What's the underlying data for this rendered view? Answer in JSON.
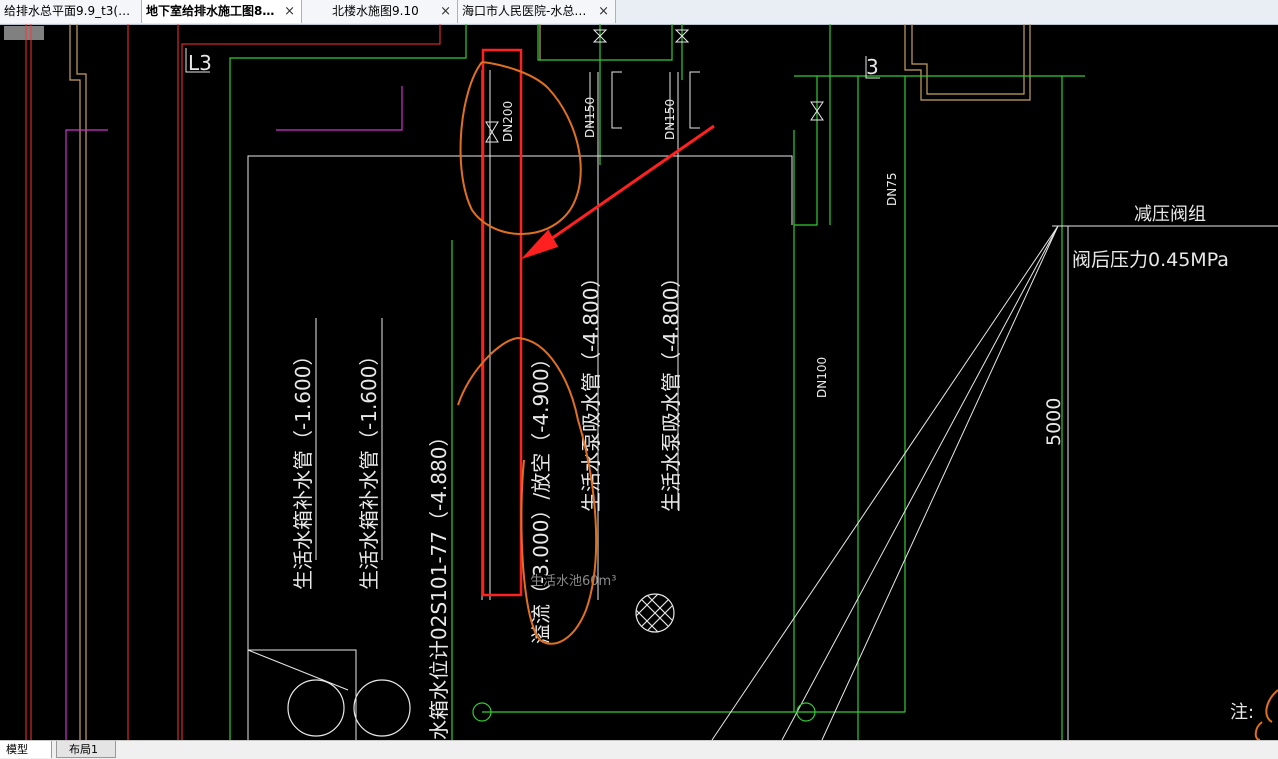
{
  "tabs": [
    {
      "label": "给排水总平面9.9_t3(…",
      "active": false
    },
    {
      "label": "地下室给排水施工图8…",
      "active": true
    },
    {
      "label": "北楼水施图9.10",
      "active": false
    },
    {
      "label": "海口市人民医院-水总…",
      "active": false
    }
  ],
  "close_glyph": "×",
  "drawing": {
    "tag_l3": "L3",
    "tag_3": "3",
    "dn200": "DN200",
    "dn150_a": "DN150",
    "dn150_b": "DN150",
    "dn75": "DN75",
    "dn100": "DN100",
    "reducer_group": "减压阀组",
    "post_valve_pressure": "阀后压力0.45MPa",
    "dim_5000": "5000",
    "refill_pipe_1": "生活水箱补水管（-1.600）",
    "refill_pipe_2": "生活水箱补水管（-1.600）",
    "level_gauge": "水箱水位计02S101-77（-4.880）",
    "overflow_drain": "溢流（-3.000）/放空（-4.900）",
    "pump_suction_1": "生活水泵吸水管（-4.800）",
    "pump_suction_2": "生活水泵吸水管（-4.800）",
    "pool_label": "生活水池60m³",
    "note": "注:"
  },
  "layout_tabs": [
    {
      "label": "模型",
      "active": true
    },
    {
      "label": "布局1",
      "active": false
    }
  ],
  "colors": {
    "background": "#000000",
    "white_line": "#ffffff",
    "green_line": "#33cc33",
    "red_line": "#ff3333",
    "magenta_line": "#cc33cc",
    "tan_line": "#c8a060",
    "annotation_red": "#ff2020",
    "annotation_orange": "#e07020"
  }
}
